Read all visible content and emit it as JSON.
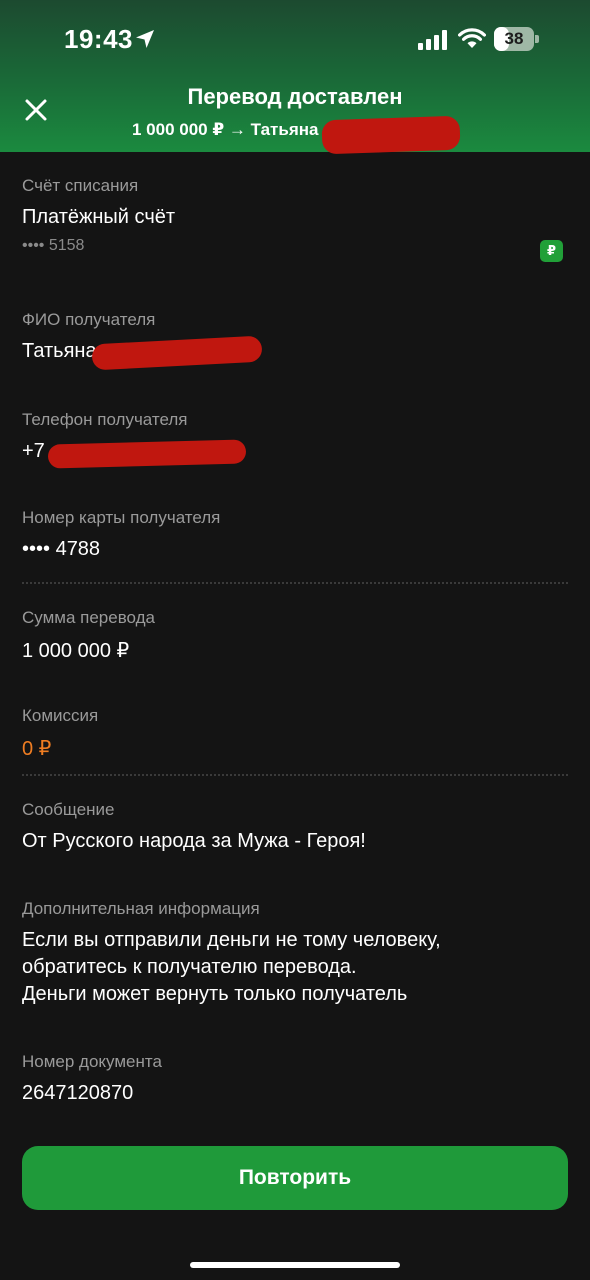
{
  "status_bar": {
    "time": "19:43",
    "battery_percent": "38",
    "battery_fill_fraction": 0.38
  },
  "header": {
    "title": "Перевод доставлен",
    "subtitle": "1 000 000 ₽ → Татьяна",
    "close_icon": "close-icon",
    "gradient_top": "#1c4a30",
    "gradient_bottom": "#1b8a3f"
  },
  "fields": {
    "account": {
      "label": "Счёт списания",
      "value": "Платёжный счёт",
      "sub": "•••• 5158",
      "badge": "₽"
    },
    "recipient_name": {
      "label": "ФИО получателя",
      "value": "Татьяна"
    },
    "recipient_phone": {
      "label": "Телефон получателя",
      "value": "+7"
    },
    "card_number": {
      "label": "Номер карты получателя",
      "value": "•••• 4788"
    },
    "amount": {
      "label": "Сумма перевода",
      "value": "1 000 000 ₽"
    },
    "commission": {
      "label": "Комиссия",
      "value": "0 ₽",
      "value_color": "#ef7d22"
    },
    "message": {
      "label": "Сообщение",
      "value": "От Русского народа за Мужа - Героя!"
    },
    "additional_info": {
      "label": "Дополнительная информация",
      "lines": [
        "Если вы отправили деньги не тому человеку,",
        "обратитесь к получателю перевода.",
        "Деньги может вернуть только получатель"
      ]
    },
    "document_number": {
      "label": "Номер документа",
      "value": "2647120870"
    }
  },
  "actions": {
    "repeat_label": "Повторить",
    "accent": "#1f9a3a"
  }
}
